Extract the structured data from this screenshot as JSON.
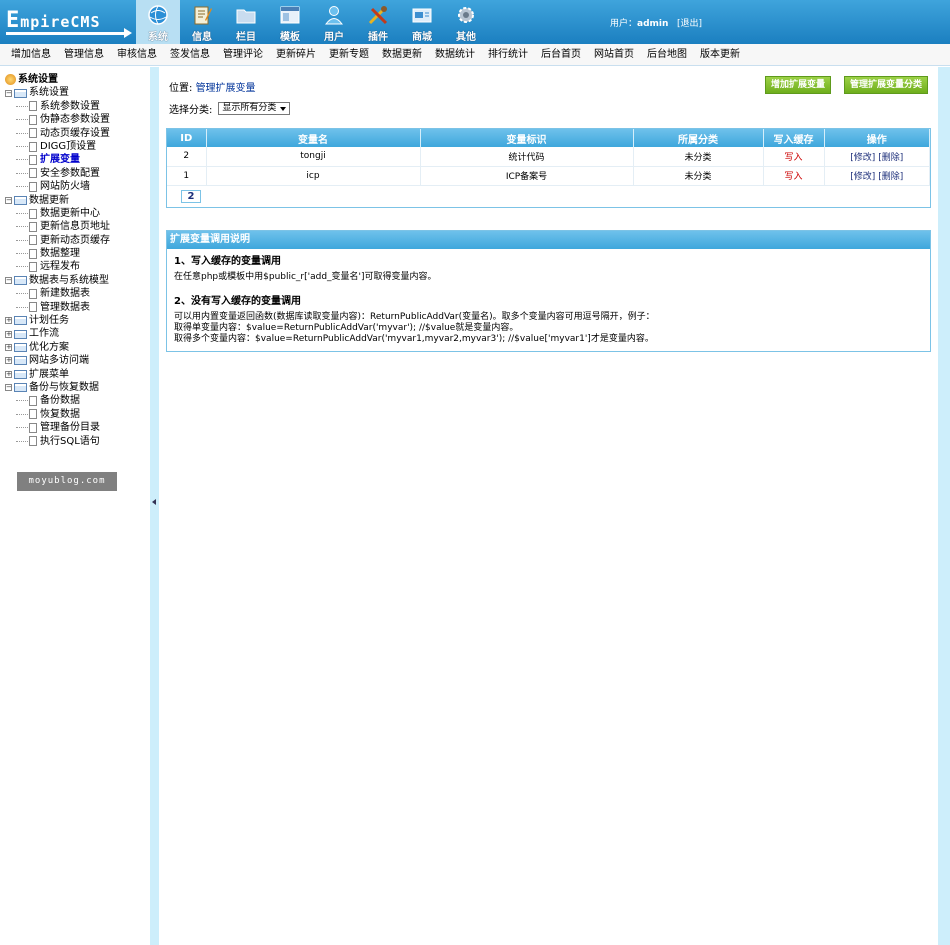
{
  "header": {
    "logo_text": "mpireCMS",
    "logo_initial": "E",
    "nav": [
      {
        "label": "系统",
        "icon": "globe-icon",
        "active": true
      },
      {
        "label": "信息",
        "icon": "notepad-icon"
      },
      {
        "label": "栏目",
        "icon": "folder-icon"
      },
      {
        "label": "模板",
        "icon": "window-icon"
      },
      {
        "label": "用户",
        "icon": "user-icon"
      },
      {
        "label": "插件",
        "icon": "tools-icon"
      },
      {
        "label": "商城",
        "icon": "card-icon"
      },
      {
        "label": "其他",
        "icon": "gear-icon"
      }
    ],
    "user_label": "用户：",
    "user_name": "admin",
    "logout": "[退出]"
  },
  "subnav": [
    "增加信息",
    "管理信息",
    "审核信息",
    "签发信息",
    "管理评论",
    "更新碎片",
    "更新专题",
    "数据更新",
    "数据统计",
    "排行统计",
    "后台首页",
    "网站首页",
    "后台地图",
    "版本更新"
  ],
  "sidebar": {
    "root": "系统设置",
    "groups": [
      {
        "label": "系统设置",
        "expanded": true,
        "items": [
          "系统参数设置",
          "伪静态参数设置",
          "动态页缓存设置",
          "DIGG顶设置",
          "扩展变量",
          "安全参数配置",
          "网站防火墙"
        ]
      },
      {
        "label": "数据更新",
        "expanded": true,
        "items": [
          "数据更新中心",
          "更新信息页地址",
          "更新动态页缓存",
          "数据整理",
          "远程发布"
        ]
      },
      {
        "label": "数据表与系统模型",
        "expanded": true,
        "items": [
          "新建数据表",
          "管理数据表"
        ]
      },
      {
        "label": "计划任务",
        "expanded": false,
        "items": []
      },
      {
        "label": "工作流",
        "expanded": false,
        "items": []
      },
      {
        "label": "优化方案",
        "expanded": false,
        "items": []
      },
      {
        "label": "网站多访问端",
        "expanded": false,
        "items": []
      },
      {
        "label": "扩展菜单",
        "expanded": false,
        "items": []
      },
      {
        "label": "备份与恢复数据",
        "expanded": true,
        "items": [
          "备份数据",
          "恢复数据",
          "管理备份目录",
          "执行SQL语句"
        ]
      }
    ],
    "active_item": "扩展变量",
    "watermark": "moyublog.com"
  },
  "main": {
    "location_label": "位置: ",
    "location_link": "管理扩展变量",
    "btn_add": "增加扩展变量",
    "btn_manage": "管理扩展变量分类",
    "category_label": "选择分类:",
    "category_value": "显示所有分类",
    "table": {
      "headers": [
        "ID",
        "变量名",
        "变量标识",
        "所属分类",
        "写入缓存",
        "操作"
      ],
      "rows": [
        {
          "id": "2",
          "name": "tongji",
          "label": "统计代码",
          "category": "未分类",
          "write": "写入",
          "edit": "[修改]",
          "del": "[删除]"
        },
        {
          "id": "1",
          "name": "icp",
          "label": "ICP备案号",
          "category": "未分类",
          "write": "写入",
          "edit": "[修改]",
          "del": "[删除]"
        }
      ],
      "page": "2"
    },
    "help": {
      "title": "扩展变量调用说明",
      "h1": "1、写入缓存的变量调用",
      "p1": "在任意php或模板中用$public_r['add_变量名']可取得变量内容。",
      "h2": "2、没有写入缓存的变量调用",
      "p2a": "可以用内置变量返回函数(数据库读取变量内容)：ReturnPublicAddVar(变量名)。取多个变量内容可用逗号隔开，例子：",
      "p2b": "取得单变量内容：$value=ReturnPublicAddVar('myvar'); //$value就是变量内容。",
      "p2c": "取得多个变量内容：$value=ReturnPublicAddVar('myvar1,myvar2,myvar3'); //$value['myvar1']才是变量内容。"
    }
  }
}
